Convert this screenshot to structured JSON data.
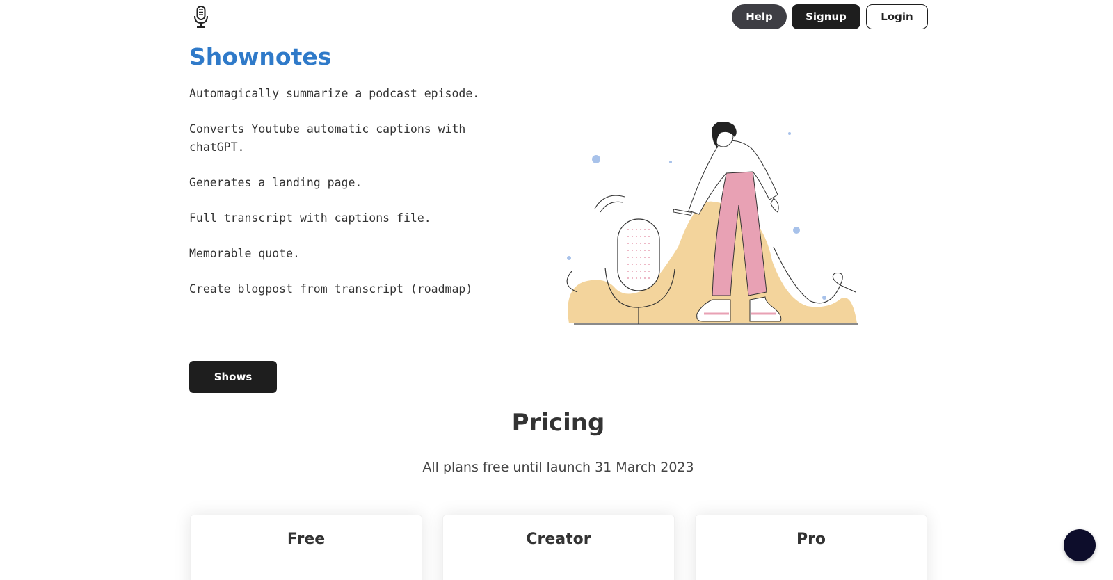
{
  "header": {
    "logo_icon": "microphone-icon",
    "nav": {
      "help": "Help",
      "signup": "Signup",
      "login": "Login"
    }
  },
  "hero": {
    "title": "Shownotes",
    "features": [
      "Automagically summarize a podcast episode.",
      "Converts Youtube automatic captions with chatGPT.",
      "Generates a landing page.",
      "Full transcript with captions file.",
      "Memorable quote.",
      "Create blogpost from transcript (roadmap)"
    ],
    "shows_button": "Shows",
    "illustration_icon": "woman-with-microphone-illustration"
  },
  "pricing": {
    "title": "Pricing",
    "subtitle": "All plans free until launch 31 March 2023",
    "plans": [
      {
        "name": "Free"
      },
      {
        "name": "Creator"
      },
      {
        "name": "Pro"
      }
    ]
  },
  "colors": {
    "accent": "#2f7ac9",
    "button_dark": "#1e1e1e",
    "help_button": "#3e3e44",
    "blob": "#f3d49c",
    "pants": "#e8a1b4",
    "dots": "#a8c2ea",
    "chat_bubble": "#0d0d2b"
  },
  "chat_widget_icon": "chat-bubble-icon"
}
